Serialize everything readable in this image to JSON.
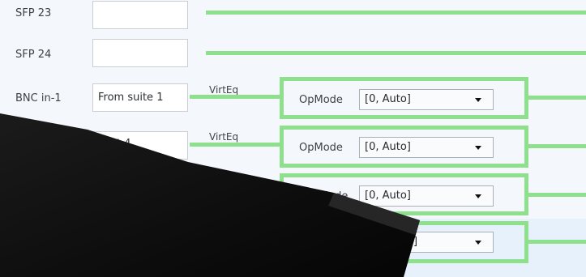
{
  "ports": [
    {
      "label": "SFP 23",
      "value": ""
    },
    {
      "label": "SFP 24",
      "value": ""
    },
    {
      "label": "BNC in-1",
      "value": "From suite 1"
    },
    {
      "label": "",
      "value": "post 4"
    }
  ],
  "virteq_label": "VirtEq",
  "opmode_label": "OpMode",
  "opmode_partial_label": "Mode",
  "opmode_rows": [
    {
      "value": "[0, Auto]"
    },
    {
      "value": "[0, Auto]"
    },
    {
      "value": "[0, Auto]"
    },
    {
      "value": "]"
    }
  ],
  "colors": {
    "link_green": "#8ee08c",
    "background": "#f4f7fb"
  }
}
